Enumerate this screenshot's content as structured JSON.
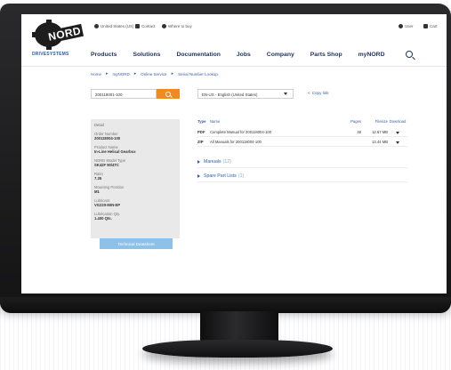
{
  "topbar": {
    "country": "United States (US)",
    "contact": "Contact",
    "where_to_buy": "Where to buy",
    "user": "User",
    "cart": "Cart"
  },
  "brand": {
    "logo_text": "NORD",
    "tagline": "DRIVESYSTEMS"
  },
  "nav": {
    "items": [
      "Products",
      "Solutions",
      "Documentation",
      "Jobs",
      "Company",
      "Parts Shop",
      "myNORD"
    ]
  },
  "breadcrumb": [
    "Home",
    "myNORD",
    "Online Service",
    "Serial Number Lookup"
  ],
  "search": {
    "serial_value": "200118001-100"
  },
  "language": {
    "selected": "EN-US - English (United States)"
  },
  "copy_link": "Copy link",
  "detail": {
    "title": "Detail",
    "fields": [
      {
        "label": "Order Number",
        "value": "200118004-100"
      },
      {
        "label": "Product Name",
        "value": "In-Line Helical Gearbox"
      },
      {
        "label": "NORD Model Type",
        "value": "SK42F 90/4TC"
      },
      {
        "label": "Ratio",
        "value": "7.35"
      },
      {
        "label": "Mounting Position",
        "value": "M1"
      },
      {
        "label": "Lubricant",
        "value": "VG220-MIN-EP"
      },
      {
        "label": "Lubrication Qty.",
        "value": "1.400 Qts."
      }
    ],
    "datasheet_button": "Technical Datasheet"
  },
  "table": {
    "headers": {
      "type": "Type",
      "name": "Name",
      "pages": "Pages",
      "filesize": "Filesize",
      "download": "Download"
    },
    "rows": [
      {
        "type": "PDF",
        "name": "Complete Manual for 200118004-100",
        "pages": "48",
        "size": "12.67 MB"
      },
      {
        "type": "ZIP",
        "name": "All Manuals for 200118004-100",
        "pages": "",
        "size": "13.44 MB"
      }
    ]
  },
  "sections": [
    {
      "label": "Manuals",
      "count": "(12)"
    },
    {
      "label": "Spare Part Lists",
      "count": "(1)"
    }
  ]
}
